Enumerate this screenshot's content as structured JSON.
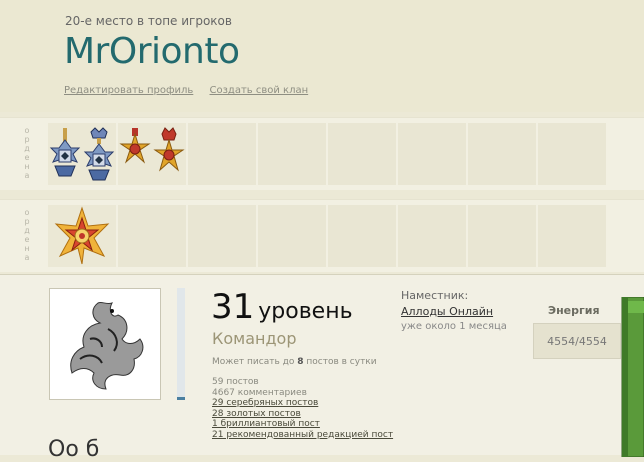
{
  "header": {
    "rank_text": "20-е место в топе игроков",
    "username": "MrOrionto",
    "links": {
      "edit_profile": "Редактировать профиль",
      "create_clan": "Создать свой клан"
    }
  },
  "orders": {
    "label": "ордена",
    "row1_medals": [
      "blue-cross-medal-icon",
      "blue-crown-cross-medal-icon",
      "gold-star-medal-icon",
      "gold-crown-star-medal-icon"
    ],
    "row2_medals": [
      "red-gold-star-medal-icon"
    ]
  },
  "profile": {
    "level_number": "31",
    "level_word": "уровень",
    "title": "Командор",
    "posts_limit_prefix": "Может писать до",
    "posts_limit_count": "8",
    "posts_limit_suffix": "постов в сутки",
    "stats": {
      "posts": "59 постов",
      "comments": "4667 комментариев",
      "silver": "29 серебряных постов",
      "gold": "28 золотых постов",
      "diamond": "1 бриллиантовый пост",
      "recommended": "21 рекомендованный редакцией пост"
    },
    "deputy_label": "Наместник:",
    "deputy_game": "Аллоды Онлайн",
    "deputy_time": "уже около 1 месяца",
    "energy_label": "Энергия",
    "energy_value": "4554/4554",
    "progress_fraction": 0.03,
    "bottom_partial": "Оо б"
  }
}
